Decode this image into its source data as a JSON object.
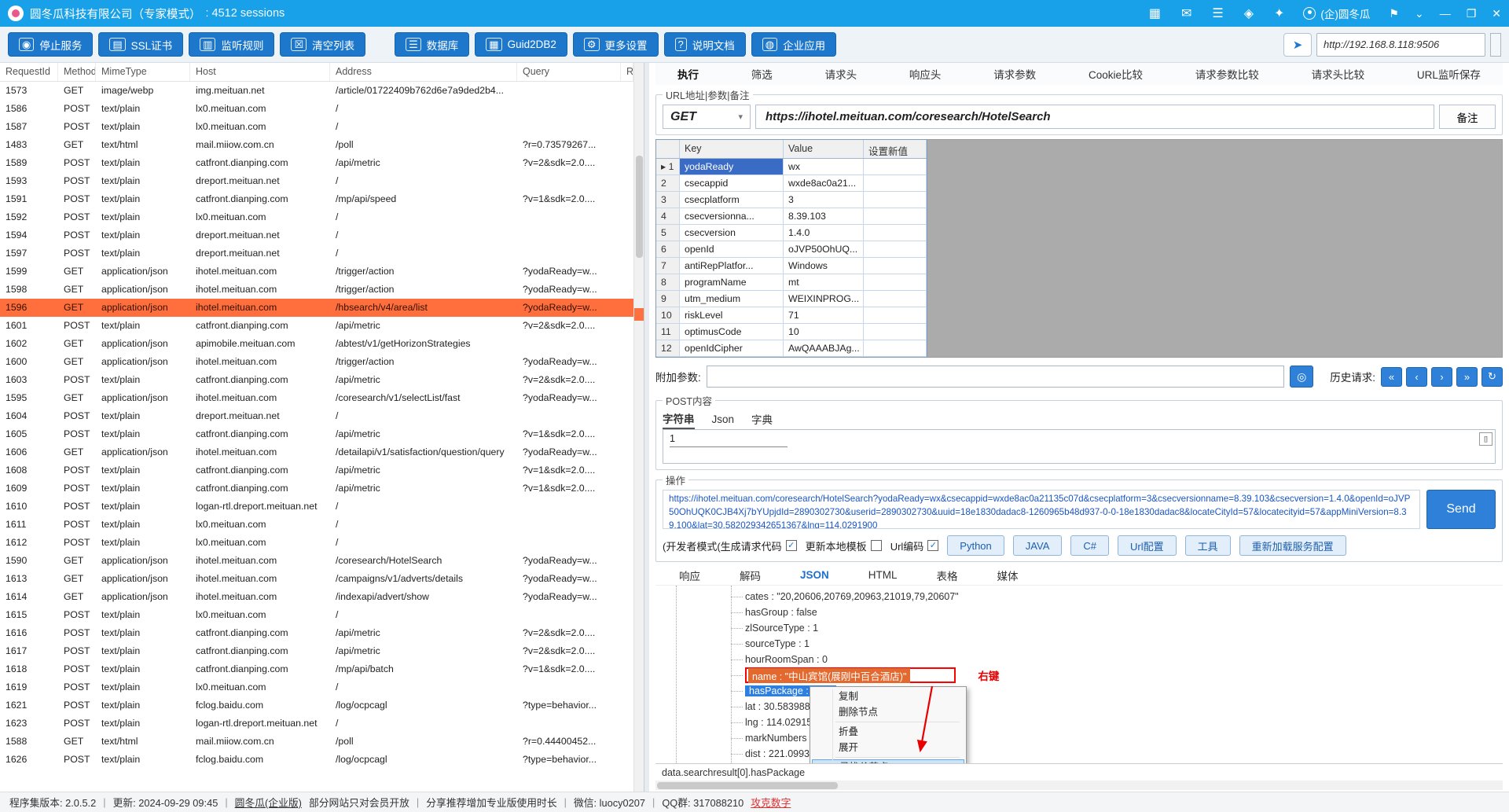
{
  "colors": {
    "titlebar": "#18a0e8",
    "toolbar_button": "#1d78cc",
    "selected_row": "#ff6f3e",
    "selected_param": "#3b6cc5",
    "send_button": "#2f80d9",
    "highlight_orange": "#e4692e",
    "highlight_blue": "#2d7fe0",
    "annotation_red": "#e80000"
  },
  "titlebar": {
    "title": "圆冬瓜科技有限公司（专家模式）",
    "sessions": ": 4512 sessions",
    "icons": [
      {
        "name": "apps-grid-icon",
        "glyph": "▦"
      },
      {
        "name": "mail-icon",
        "glyph": "✉"
      },
      {
        "name": "database-icon",
        "glyph": "☰"
      },
      {
        "name": "gift-icon",
        "glyph": "◈"
      },
      {
        "name": "cart-icon",
        "glyph": "✦"
      }
    ],
    "user": "(企)圆冬瓜",
    "window_controls": [
      {
        "name": "pin-icon",
        "glyph": "⚑"
      },
      {
        "name": "chevron-down-icon",
        "glyph": "⌄"
      },
      {
        "name": "minimize-icon",
        "glyph": "—"
      },
      {
        "name": "maximize-icon",
        "glyph": "❐"
      },
      {
        "name": "close-icon",
        "glyph": "✕"
      }
    ]
  },
  "toolbar": {
    "buttons": [
      {
        "name": "stop-service-button",
        "icon": "stop-icon",
        "glyph": "◉",
        "label": "停止服务"
      },
      {
        "name": "ssl-cert-button",
        "icon": "certificate-icon",
        "glyph": "▤",
        "label": "SSL证书"
      },
      {
        "name": "listen-rules-button",
        "icon": "monitor-icon",
        "glyph": "▥",
        "label": "监听规则"
      },
      {
        "name": "clear-list-button",
        "icon": "clear-icon",
        "glyph": "☒",
        "label": "清空列表"
      },
      {
        "name": "database-button",
        "icon": "database-icon",
        "glyph": "☰",
        "label": "数据库",
        "gap": true
      },
      {
        "name": "guid2db2-button",
        "icon": "table-icon",
        "glyph": "▦",
        "label": "Guid2DB2"
      },
      {
        "name": "more-settings-button",
        "icon": "gear-icon",
        "glyph": "⚙",
        "label": "更多设置"
      },
      {
        "name": "docs-button",
        "icon": "help-icon",
        "glyph": "?",
        "label": "说明文档"
      },
      {
        "name": "enterprise-button",
        "icon": "globe-icon",
        "glyph": "◍",
        "label": "企业应用"
      }
    ],
    "share_glyph": "➤",
    "proxy_url": "http://192.168.8.118:9506"
  },
  "sessions": {
    "columns": [
      {
        "key": "requestid",
        "label": "RequestId"
      },
      {
        "key": "method",
        "label": "Method"
      },
      {
        "key": "mimetype",
        "label": "MimeType"
      },
      {
        "key": "host",
        "label": "Host"
      },
      {
        "key": "address",
        "label": "Address"
      },
      {
        "key": "query",
        "label": "Query"
      },
      {
        "key": "remark",
        "label": "Rema"
      }
    ],
    "selected_id": "1596",
    "rows": [
      {
        "id": "1573",
        "method": "GET",
        "mime": "image/webp",
        "host": "img.meituan.net",
        "address": "/article/01722409b762d6e7a9ded2b4...",
        "query": ""
      },
      {
        "id": "1586",
        "method": "POST",
        "mime": "text/plain",
        "host": "lx0.meituan.com",
        "address": "/",
        "query": ""
      },
      {
        "id": "1587",
        "method": "POST",
        "mime": "text/plain",
        "host": "lx0.meituan.com",
        "address": "/",
        "query": ""
      },
      {
        "id": "1483",
        "method": "GET",
        "mime": "text/html",
        "host": "mail.miiow.com.cn",
        "address": "/poll",
        "query": "?r=0.73579267..."
      },
      {
        "id": "1589",
        "method": "POST",
        "mime": "text/plain",
        "host": "catfront.dianping.com",
        "address": "/api/metric",
        "query": "?v=2&sdk=2.0...."
      },
      {
        "id": "1593",
        "method": "POST",
        "mime": "text/plain",
        "host": "dreport.meituan.net",
        "address": "/",
        "query": ""
      },
      {
        "id": "1591",
        "method": "POST",
        "mime": "text/plain",
        "host": "catfront.dianping.com",
        "address": "/mp/api/speed",
        "query": "?v=1&sdk=2.0...."
      },
      {
        "id": "1592",
        "method": "POST",
        "mime": "text/plain",
        "host": "lx0.meituan.com",
        "address": "/",
        "query": ""
      },
      {
        "id": "1594",
        "method": "POST",
        "mime": "text/plain",
        "host": "dreport.meituan.net",
        "address": "/",
        "query": ""
      },
      {
        "id": "1597",
        "method": "POST",
        "mime": "text/plain",
        "host": "dreport.meituan.net",
        "address": "/",
        "query": ""
      },
      {
        "id": "1599",
        "method": "GET",
        "mime": "application/json",
        "host": "ihotel.meituan.com",
        "address": "/trigger/action",
        "query": "?yodaReady=w..."
      },
      {
        "id": "1598",
        "method": "GET",
        "mime": "application/json",
        "host": "ihotel.meituan.com",
        "address": "/trigger/action",
        "query": "?yodaReady=w..."
      },
      {
        "id": "1596",
        "method": "GET",
        "mime": "application/json",
        "host": "ihotel.meituan.com",
        "address": "/hbsearch/v4/area/list",
        "query": "?yodaReady=w..."
      },
      {
        "id": "1601",
        "method": "POST",
        "mime": "text/plain",
        "host": "catfront.dianping.com",
        "address": "/api/metric",
        "query": "?v=2&sdk=2.0...."
      },
      {
        "id": "1602",
        "method": "GET",
        "mime": "application/json",
        "host": "apimobile.meituan.com",
        "address": "/abtest/v1/getHorizonStrategies",
        "query": ""
      },
      {
        "id": "1600",
        "method": "GET",
        "mime": "application/json",
        "host": "ihotel.meituan.com",
        "address": "/trigger/action",
        "query": "?yodaReady=w..."
      },
      {
        "id": "1603",
        "method": "POST",
        "mime": "text/plain",
        "host": "catfront.dianping.com",
        "address": "/api/metric",
        "query": "?v=2&sdk=2.0...."
      },
      {
        "id": "1595",
        "method": "GET",
        "mime": "application/json",
        "host": "ihotel.meituan.com",
        "address": "/coresearch/v1/selectList/fast",
        "query": "?yodaReady=w..."
      },
      {
        "id": "1604",
        "method": "POST",
        "mime": "text/plain",
        "host": "dreport.meituan.net",
        "address": "/",
        "query": ""
      },
      {
        "id": "1605",
        "method": "POST",
        "mime": "text/plain",
        "host": "catfront.dianping.com",
        "address": "/api/metric",
        "query": "?v=1&sdk=2.0...."
      },
      {
        "id": "1606",
        "method": "GET",
        "mime": "application/json",
        "host": "ihotel.meituan.com",
        "address": "/detailapi/v1/satisfaction/question/query",
        "query": "?yodaReady=w..."
      },
      {
        "id": "1608",
        "method": "POST",
        "mime": "text/plain",
        "host": "catfront.dianping.com",
        "address": "/api/metric",
        "query": "?v=1&sdk=2.0...."
      },
      {
        "id": "1609",
        "method": "POST",
        "mime": "text/plain",
        "host": "catfront.dianping.com",
        "address": "/api/metric",
        "query": "?v=1&sdk=2.0...."
      },
      {
        "id": "1610",
        "method": "POST",
        "mime": "text/plain",
        "host": "logan-rtl.dreport.meituan.net",
        "address": "/",
        "query": ""
      },
      {
        "id": "1611",
        "method": "POST",
        "mime": "text/plain",
        "host": "lx0.meituan.com",
        "address": "/",
        "query": ""
      },
      {
        "id": "1612",
        "method": "POST",
        "mime": "text/plain",
        "host": "lx0.meituan.com",
        "address": "/",
        "query": ""
      },
      {
        "id": "1590",
        "method": "GET",
        "mime": "application/json",
        "host": "ihotel.meituan.com",
        "address": "/coresearch/HotelSearch",
        "query": "?yodaReady=w..."
      },
      {
        "id": "1613",
        "method": "GET",
        "mime": "application/json",
        "host": "ihotel.meituan.com",
        "address": "/campaigns/v1/adverts/details",
        "query": "?yodaReady=w..."
      },
      {
        "id": "1614",
        "method": "GET",
        "mime": "application/json",
        "host": "ihotel.meituan.com",
        "address": "/indexapi/advert/show",
        "query": "?yodaReady=w..."
      },
      {
        "id": "1615",
        "method": "POST",
        "mime": "text/plain",
        "host": "lx0.meituan.com",
        "address": "/",
        "query": ""
      },
      {
        "id": "1616",
        "method": "POST",
        "mime": "text/plain",
        "host": "catfront.dianping.com",
        "address": "/api/metric",
        "query": "?v=2&sdk=2.0...."
      },
      {
        "id": "1617",
        "method": "POST",
        "mime": "text/plain",
        "host": "catfront.dianping.com",
        "address": "/api/metric",
        "query": "?v=2&sdk=2.0...."
      },
      {
        "id": "1618",
        "method": "POST",
        "mime": "text/plain",
        "host": "catfront.dianping.com",
        "address": "/mp/api/batch",
        "query": "?v=1&sdk=2.0...."
      },
      {
        "id": "1619",
        "method": "POST",
        "mime": "text/plain",
        "host": "lx0.meituan.com",
        "address": "/",
        "query": ""
      },
      {
        "id": "1621",
        "method": "POST",
        "mime": "text/plain",
        "host": "fclog.baidu.com",
        "address": "/log/ocpcagl",
        "query": "?type=behavior..."
      },
      {
        "id": "1623",
        "method": "POST",
        "mime": "text/plain",
        "host": "logan-rtl.dreport.meituan.net",
        "address": "/",
        "query": ""
      },
      {
        "id": "1588",
        "method": "GET",
        "mime": "text/html",
        "host": "mail.miiow.com.cn",
        "address": "/poll",
        "query": "?r=0.44400452..."
      },
      {
        "id": "1626",
        "method": "POST",
        "mime": "text/plain",
        "host": "fclog.baidu.com",
        "address": "/log/ocpcagl",
        "query": "?type=behavior..."
      }
    ]
  },
  "right": {
    "tabs": [
      "执行",
      "筛选",
      "请求头",
      "响应头",
      "请求参数",
      "Cookie比较",
      "请求参数比较",
      "请求头比较",
      "URL监听保存"
    ],
    "active_tab": 0,
    "url_group": {
      "title": "URL地址|参数|备注",
      "method": "GET",
      "caret": "▾",
      "url": "https://ihotel.meituan.com/coresearch/HotelSearch",
      "note_button": "备注"
    },
    "params": {
      "columns": [
        "",
        "Key",
        "Value",
        "设置新值"
      ],
      "rows": [
        {
          "n": "1",
          "key": "yodaReady",
          "value": "wx"
        },
        {
          "n": "2",
          "key": "csecappid",
          "value": "wxde8ac0a21..."
        },
        {
          "n": "3",
          "key": "csecplatform",
          "value": "3"
        },
        {
          "n": "4",
          "key": "csecversionna...",
          "value": "8.39.103"
        },
        {
          "n": "5",
          "key": "csecversion",
          "value": "1.4.0"
        },
        {
          "n": "6",
          "key": "openId",
          "value": "oJVP50OhUQ..."
        },
        {
          "n": "7",
          "key": "antiRepPlatfor...",
          "value": "Windows"
        },
        {
          "n": "8",
          "key": "programName",
          "value": "mt"
        },
        {
          "n": "9",
          "key": "utm_medium",
          "value": "WEIXINPROG..."
        },
        {
          "n": "10",
          "key": "riskLevel",
          "value": "71"
        },
        {
          "n": "11",
          "key": "optimusCode",
          "value": "10"
        },
        {
          "n": "12",
          "key": "openIdCipher",
          "value": "AwQAAABJAg..."
        }
      ],
      "row_marker": "▸"
    },
    "extra": {
      "label": "附加参数:",
      "attach_glyph": "◎",
      "history_label": "历史请求:",
      "history_buttons": [
        {
          "name": "history-first-button",
          "glyph": "«"
        },
        {
          "name": "history-prev-button",
          "glyph": "‹"
        },
        {
          "name": "history-next-button",
          "glyph": "›"
        },
        {
          "name": "history-last-button",
          "glyph": "»"
        },
        {
          "name": "history-refresh-button",
          "glyph": "↻"
        }
      ]
    },
    "post_group": {
      "title": "POST内容",
      "tabs": [
        "字符串",
        "Json",
        "字典"
      ],
      "active_tab": 0,
      "content": "1",
      "format_glyph": "[]"
    },
    "action_group": {
      "title": "操作",
      "request_text": "https://ihotel.meituan.com/coresearch/HotelSearch?yodaReady=wx&csecappid=wxde8ac0a21135c07d&csecplatform=3&csecversionname=8.39.103&csecversion=1.4.0&openId=oJVP50OhUQK0CJB4Xj7bYUpjdId=2890302730&userid=2890302730&uuid=18e1830dadac8-1260965b48d937-0-0-18e1830dadac8&locateCityId=57&locatecityid=57&appMiniVersion=8.39.100&lat=30.582029342651367&lng=114.0291900",
      "send_label": "Send",
      "checkboxes": [
        {
          "name": "dev-mode",
          "label": "(开发者模式(生成请求代码",
          "checked": true
        },
        {
          "name": "update-template",
          "label": "更新本地模板",
          "checked": false
        },
        {
          "name": "url-encode",
          "label": "Url编码",
          "checked": true
        }
      ],
      "code_buttons": [
        "Python",
        "JAVA",
        "C#",
        "Url配置",
        "工具",
        "重新加载服务配置"
      ]
    },
    "response": {
      "tabs": [
        "响应",
        "解码",
        "JSON",
        "HTML",
        "表格",
        "媒体"
      ],
      "active_tab": 2,
      "tree": [
        {
          "text": "cates : \"20,20606,20769,20963,21019,79,20607\""
        },
        {
          "text": "hasGroup : false"
        },
        {
          "text": "zlSourceType : 1"
        },
        {
          "text": "sourceType : 1"
        },
        {
          "text": "hourRoomSpan : 0"
        },
        {
          "text": "name : \"中山宾馆(展刚中百合酒店)\"",
          "highlight": "red"
        },
        {
          "text": "hasPackage : false",
          "highlight": "blue"
        },
        {
          "text": "lat : 30.583988"
        },
        {
          "text": "lng : 114.029155"
        },
        {
          "text": "markNumbers : "
        },
        {
          "text": "dist : 221.09938"
        }
      ],
      "annotation": "右键",
      "context_menu": [
        {
          "label": "复制"
        },
        {
          "label": "删除节点",
          "sep_after": true
        },
        {
          "label": "折叠"
        },
        {
          "label": "展开",
          "sep_after": true
        },
        {
          "label": "寻找父节点",
          "active": true
        }
      ],
      "status": "data.searchresult[0].hasPackage"
    }
  },
  "statusbar": {
    "segments": [
      {
        "text": "程序集版本:  2.0.5.2"
      },
      {
        "text": "|",
        "style": "sep"
      },
      {
        "text": "更新:  2024-09-29 09:45"
      },
      {
        "text": "|",
        "style": "sep"
      },
      {
        "text": "圆冬瓜(企业版)",
        "style": "link"
      },
      {
        "text": "部分网站只对会员开放"
      },
      {
        "text": "|",
        "style": "sep"
      },
      {
        "text": "分享推荐增加专业版使用时长"
      },
      {
        "text": "|",
        "style": "sep"
      },
      {
        "text": "微信:  luocy0207"
      },
      {
        "text": "|",
        "style": "sep"
      },
      {
        "text": "QQ群:  317088210"
      },
      {
        "text": "攻克数字",
        "style": "red"
      }
    ]
  }
}
